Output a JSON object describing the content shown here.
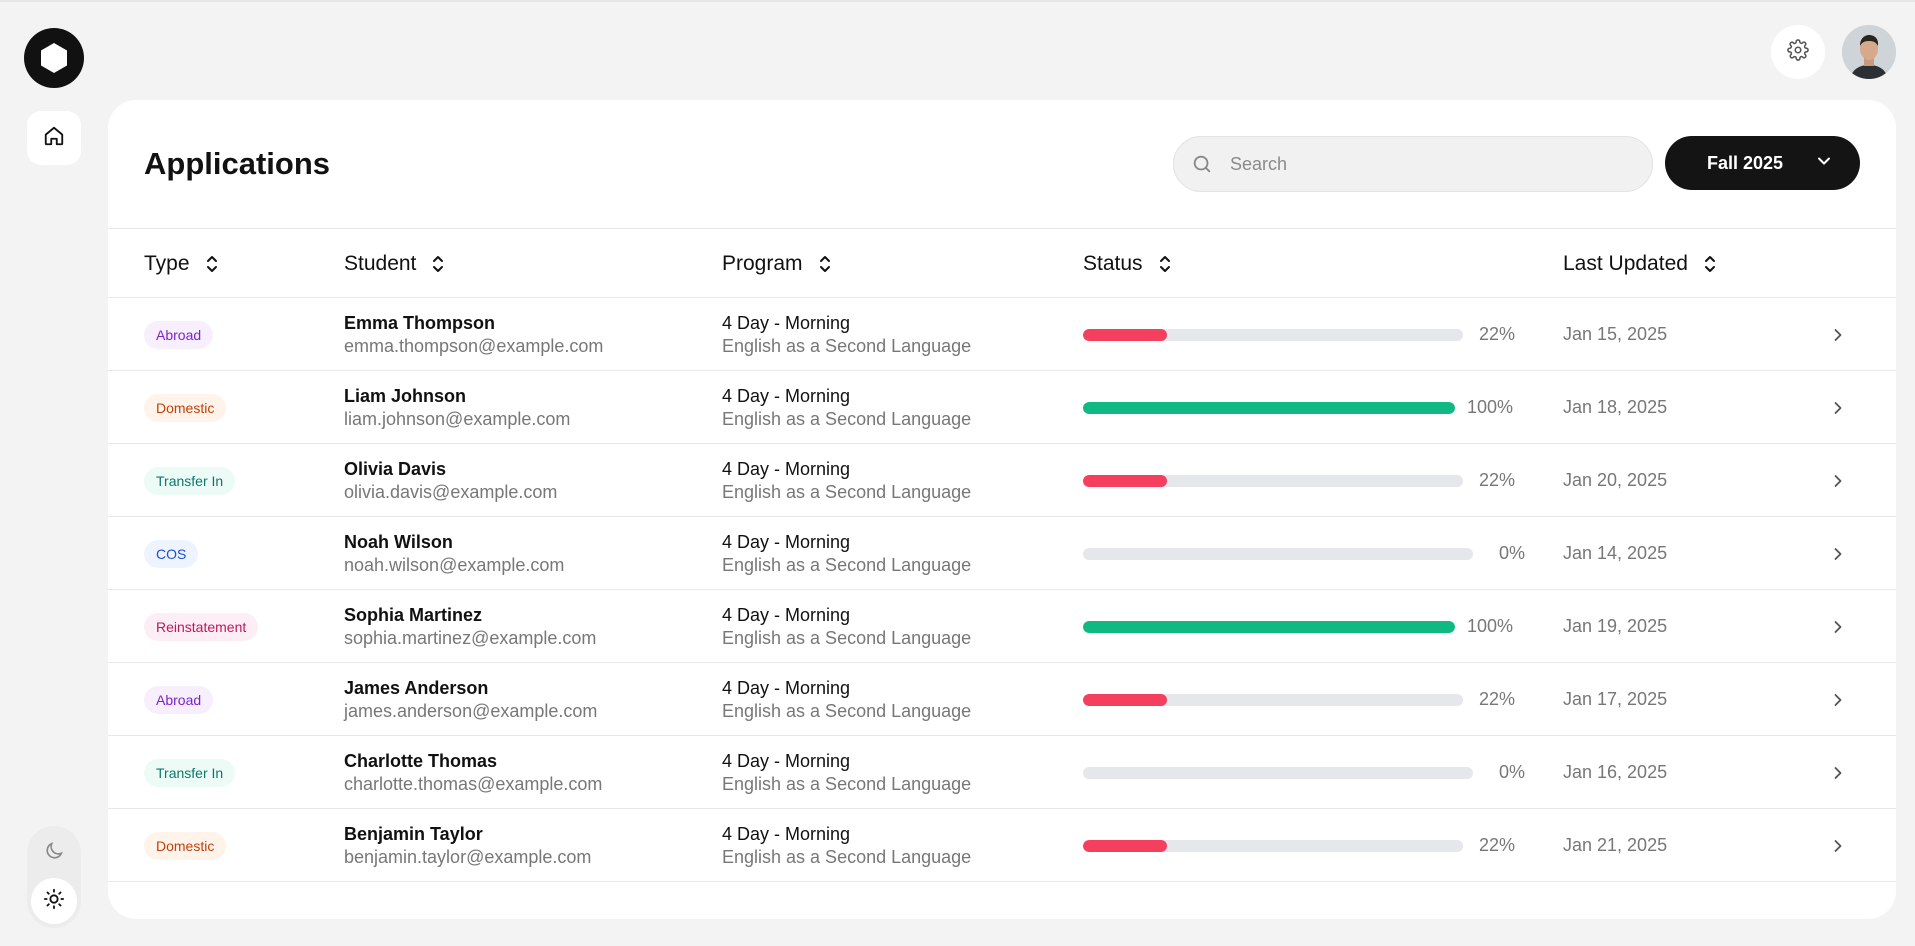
{
  "page": {
    "title": "Applications"
  },
  "search": {
    "placeholder": "Search"
  },
  "term_select": {
    "value": "Fall 2025"
  },
  "colors": {
    "danger": "#f43f5e",
    "success": "#10b981",
    "track": "#e5e7eb"
  },
  "icons": {
    "logo": "hexagon-logo-icon",
    "home": "home-icon",
    "settings": "gear-icon",
    "moon": "moon-icon",
    "sun": "sun-icon",
    "search": "search-icon",
    "sort": "sort-icon",
    "row_open": "chevron-right-icon",
    "dropdown": "chevron-down-icon"
  },
  "table": {
    "columns": [
      "Type",
      "Student",
      "Program",
      "Status",
      "Last Updated"
    ],
    "rows": [
      {
        "type": "Abroad",
        "name": "Emma Thompson",
        "email": "emma.thompson@example.com",
        "program": "4 Day - Morning",
        "program_detail": "English as a Second Language",
        "progress": 22,
        "progress_label": "22%",
        "updated": "Jan 15, 2025"
      },
      {
        "type": "Domestic",
        "name": "Liam Johnson",
        "email": "liam.johnson@example.com",
        "program": "4 Day - Morning",
        "program_detail": "English as a Second Language",
        "progress": 100,
        "progress_label": "100%",
        "updated": "Jan 18, 2025"
      },
      {
        "type": "Transfer In",
        "name": "Olivia Davis",
        "email": "olivia.davis@example.com",
        "program": "4 Day - Morning",
        "program_detail": "English as a Second Language",
        "progress": 22,
        "progress_label": "22%",
        "updated": "Jan 20, 2025"
      },
      {
        "type": "COS",
        "name": "Noah Wilson",
        "email": "noah.wilson@example.com",
        "program": "4 Day - Morning",
        "program_detail": "English as a Second Language",
        "progress": 0,
        "progress_label": "0%",
        "updated": "Jan 14, 2025"
      },
      {
        "type": "Reinstatement",
        "name": "Sophia Martinez",
        "email": "sophia.martinez@example.com",
        "program": "4 Day - Morning",
        "program_detail": "English as a Second Language",
        "progress": 100,
        "progress_label": "100%",
        "updated": "Jan 19, 2025"
      },
      {
        "type": "Abroad",
        "name": "James Anderson",
        "email": "james.anderson@example.com",
        "program": "4 Day - Morning",
        "program_detail": "English as a Second Language",
        "progress": 22,
        "progress_label": "22%",
        "updated": "Jan 17, 2025"
      },
      {
        "type": "Transfer In",
        "name": "Charlotte Thomas",
        "email": "charlotte.thomas@example.com",
        "program": "4 Day - Morning",
        "program_detail": "English as a Second Language",
        "progress": 0,
        "progress_label": "0%",
        "updated": "Jan 16, 2025"
      },
      {
        "type": "Domestic",
        "name": "Benjamin Taylor",
        "email": "benjamin.taylor@example.com",
        "program": "4 Day - Morning",
        "program_detail": "English as a Second Language",
        "progress": 22,
        "progress_label": "22%",
        "updated": "Jan 21, 2025"
      }
    ]
  }
}
